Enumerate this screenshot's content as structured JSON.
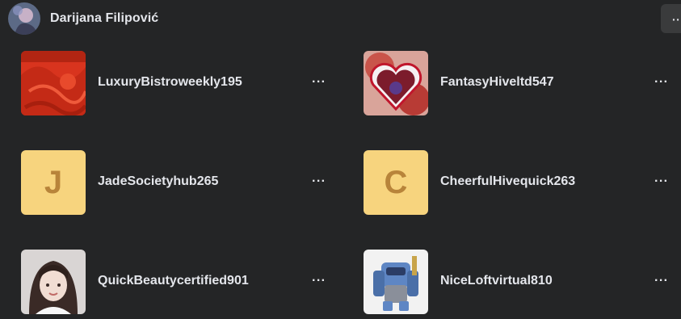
{
  "header": {
    "name": "Darijana Filipović",
    "menu_label": "···"
  },
  "items": [
    {
      "name": "LuxuryBistroweekly195",
      "thumb": "image-red-cover",
      "more": "···"
    },
    {
      "name": "FantasyHiveltd547",
      "thumb": "image-heart-character",
      "more": "···"
    },
    {
      "name": "JadeSocietyhub265",
      "thumb": "letter-avatar",
      "letter": "J",
      "more": "···"
    },
    {
      "name": "CheerfulHivequick263",
      "thumb": "letter-avatar",
      "letter": "C",
      "more": "···"
    },
    {
      "name": "QuickBeautycertified901",
      "thumb": "image-person-photo",
      "more": "···"
    },
    {
      "name": "NiceLoftvirtual810",
      "thumb": "image-robot-figure",
      "more": "···"
    }
  ],
  "colors": {
    "background": "#242526",
    "letter_avatar_bg": "#f7d47e",
    "letter_avatar_fg": "#b8843a",
    "text": "#e4e6eb"
  }
}
